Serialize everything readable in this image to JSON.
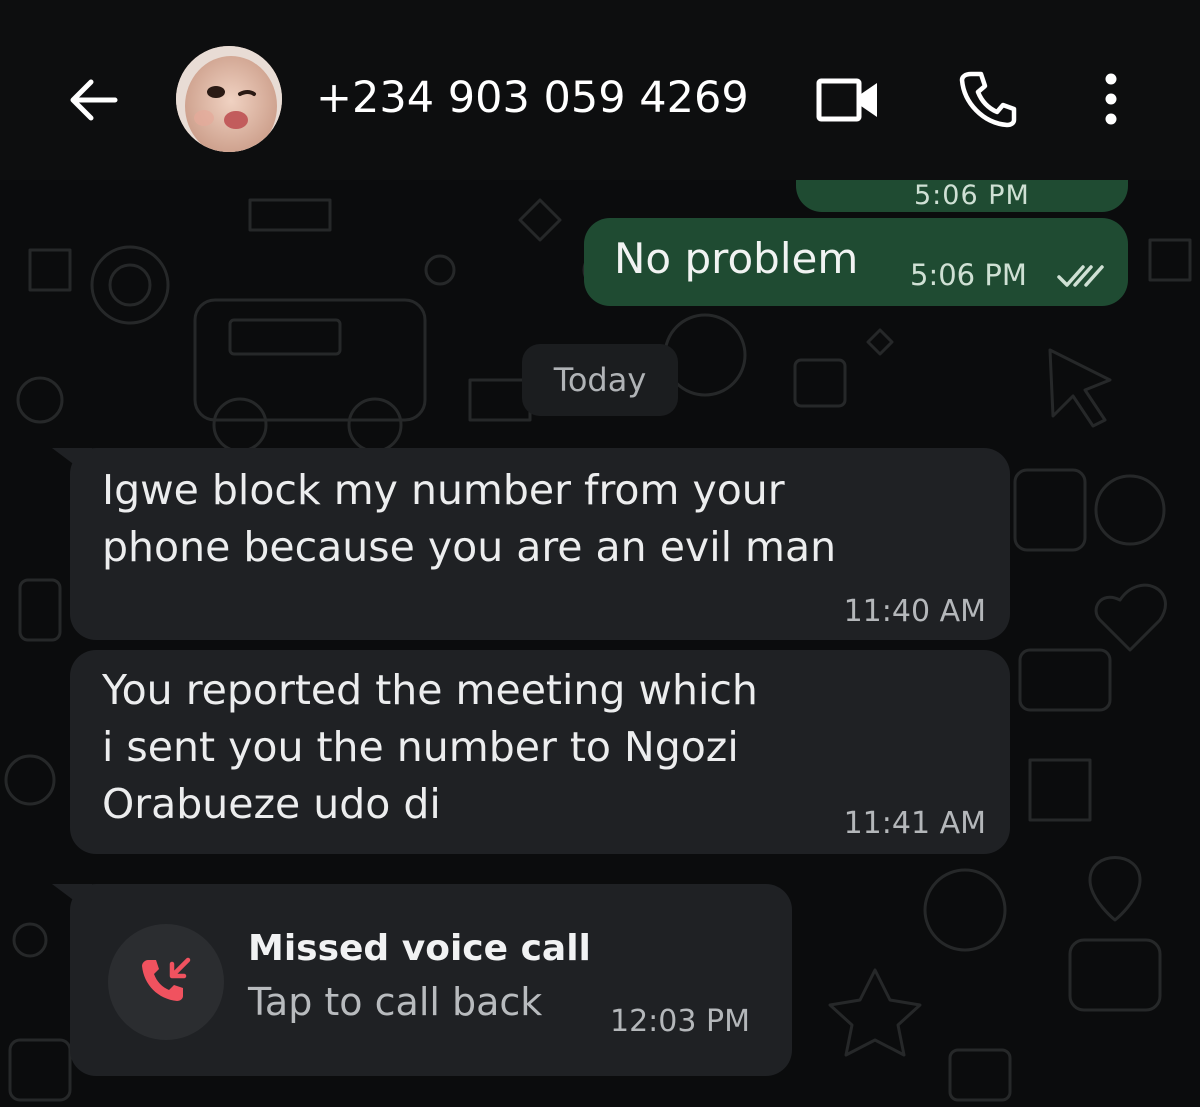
{
  "header": {
    "contact_name": "+234 903 059 4269",
    "icons": [
      "arrow-left-icon",
      "video-camera-icon",
      "phone-icon",
      "more-vertical-icon"
    ]
  },
  "messages": {
    "previous_outgoing": {
      "time": "5:06 PM"
    },
    "outgoing": {
      "text": "No problem",
      "time": "5:06 PM",
      "status": "read-ticks"
    },
    "date_divider": "Today",
    "incoming": [
      {
        "text": "Igwe block my number from your\nphone because you are an evil man",
        "time": "11:40 AM"
      },
      {
        "text": "You reported the meeting which\ni sent you the number to Ngozi\nOrabueze udo di",
        "time": "11:41 AM"
      }
    ],
    "missed_call": {
      "title": "Missed voice call",
      "subtitle": "Tap to call back",
      "time": "12:03 PM",
      "icon": "missed-call-icon"
    }
  },
  "colors": {
    "header_bg": "#0d0e0f",
    "chat_bg": "#0b0c0d",
    "outgoing_bubble": "#1f4b32",
    "incoming_bubble": "#1f2124",
    "missed_call_red": "#f0525f"
  }
}
